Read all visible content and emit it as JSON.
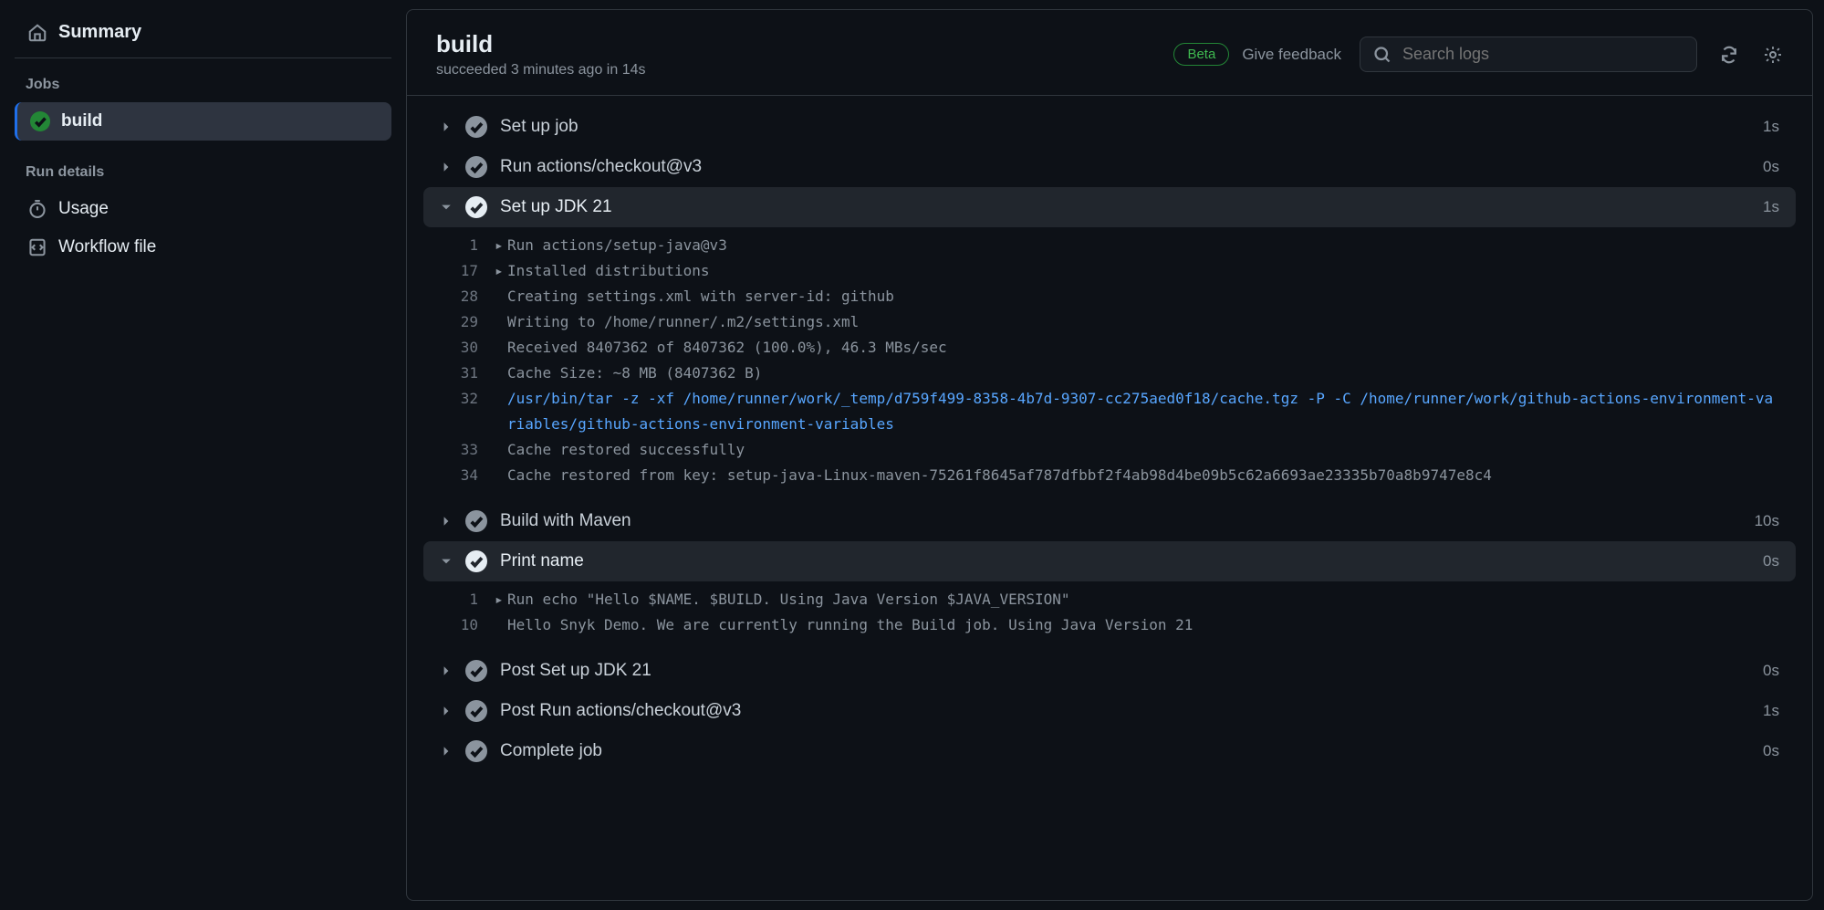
{
  "sidebar": {
    "summary_label": "Summary",
    "jobs_heading": "Jobs",
    "job_name": "build",
    "run_details_heading": "Run details",
    "usage_label": "Usage",
    "workflow_file_label": "Workflow file"
  },
  "header": {
    "title": "build",
    "subtitle": "succeeded 3 minutes ago in 14s",
    "beta_label": "Beta",
    "feedback_label": "Give feedback",
    "search_placeholder": "Search logs"
  },
  "steps": [
    {
      "name": "Set up job",
      "time": "1s",
      "expanded": false
    },
    {
      "name": "Run actions/checkout@v3",
      "time": "0s",
      "expanded": false
    },
    {
      "name": "Set up JDK 21",
      "time": "1s",
      "expanded": true,
      "logs": [
        {
          "num": "1",
          "foldable": true,
          "text": "Run actions/setup-java@v3"
        },
        {
          "num": "17",
          "foldable": true,
          "text": "Installed distributions"
        },
        {
          "num": "28",
          "text": "Creating settings.xml with server-id: github"
        },
        {
          "num": "29",
          "text": "Writing to /home/runner/.m2/settings.xml"
        },
        {
          "num": "30",
          "text": "Received 8407362 of 8407362 (100.0%), 46.3 MBs/sec"
        },
        {
          "num": "31",
          "text": "Cache Size: ~8 MB (8407362 B)"
        },
        {
          "num": "32",
          "link": true,
          "text": "/usr/bin/tar -z -xf /home/runner/work/_temp/d759f499-8358-4b7d-9307-cc275aed0f18/cache.tgz -P -C /home/runner/work/github-actions-environment-variables/github-actions-environment-variables"
        },
        {
          "num": "33",
          "text": "Cache restored successfully"
        },
        {
          "num": "34",
          "text": "Cache restored from key: setup-java-Linux-maven-75261f8645af787dfbbf2f4ab98d4be09b5c62a6693ae23335b70a8b9747e8c4"
        }
      ]
    },
    {
      "name": "Build with Maven",
      "time": "10s",
      "expanded": false
    },
    {
      "name": "Print name",
      "time": "0s",
      "expanded": true,
      "logs": [
        {
          "num": "1",
          "foldable": true,
          "text": "Run echo \"Hello $NAME. $BUILD. Using Java Version $JAVA_VERSION\""
        },
        {
          "num": "10",
          "text": "Hello Snyk Demo. We are currently running the Build job. Using Java Version 21"
        }
      ]
    },
    {
      "name": "Post Set up JDK 21",
      "time": "0s",
      "expanded": false
    },
    {
      "name": "Post Run actions/checkout@v3",
      "time": "1s",
      "expanded": false
    },
    {
      "name": "Complete job",
      "time": "0s",
      "expanded": false
    }
  ]
}
